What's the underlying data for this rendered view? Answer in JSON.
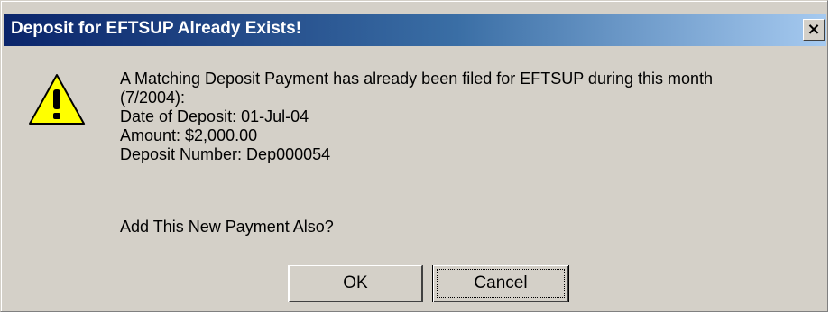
{
  "dialog": {
    "title": "Deposit for EFTSUP Already Exists!",
    "close_glyph": "×",
    "icon": "warning-icon",
    "message_lines": [
      "A Matching Deposit Payment has already been filed for EFTSUP during this month",
      "(7/2004):",
      "Date of Deposit: 01-Jul-04",
      "Amount: $2,000.00",
      "Deposit Number: Dep000054"
    ],
    "question": "Add This New Payment Also?",
    "buttons": {
      "ok_label": "OK",
      "cancel_label": "Cancel"
    }
  },
  "colors": {
    "title_bar_start": "#0a246a",
    "title_bar_end": "#a6caf0",
    "dialog_face": "#d4d0c8",
    "warning_fill": "#ffff00"
  }
}
